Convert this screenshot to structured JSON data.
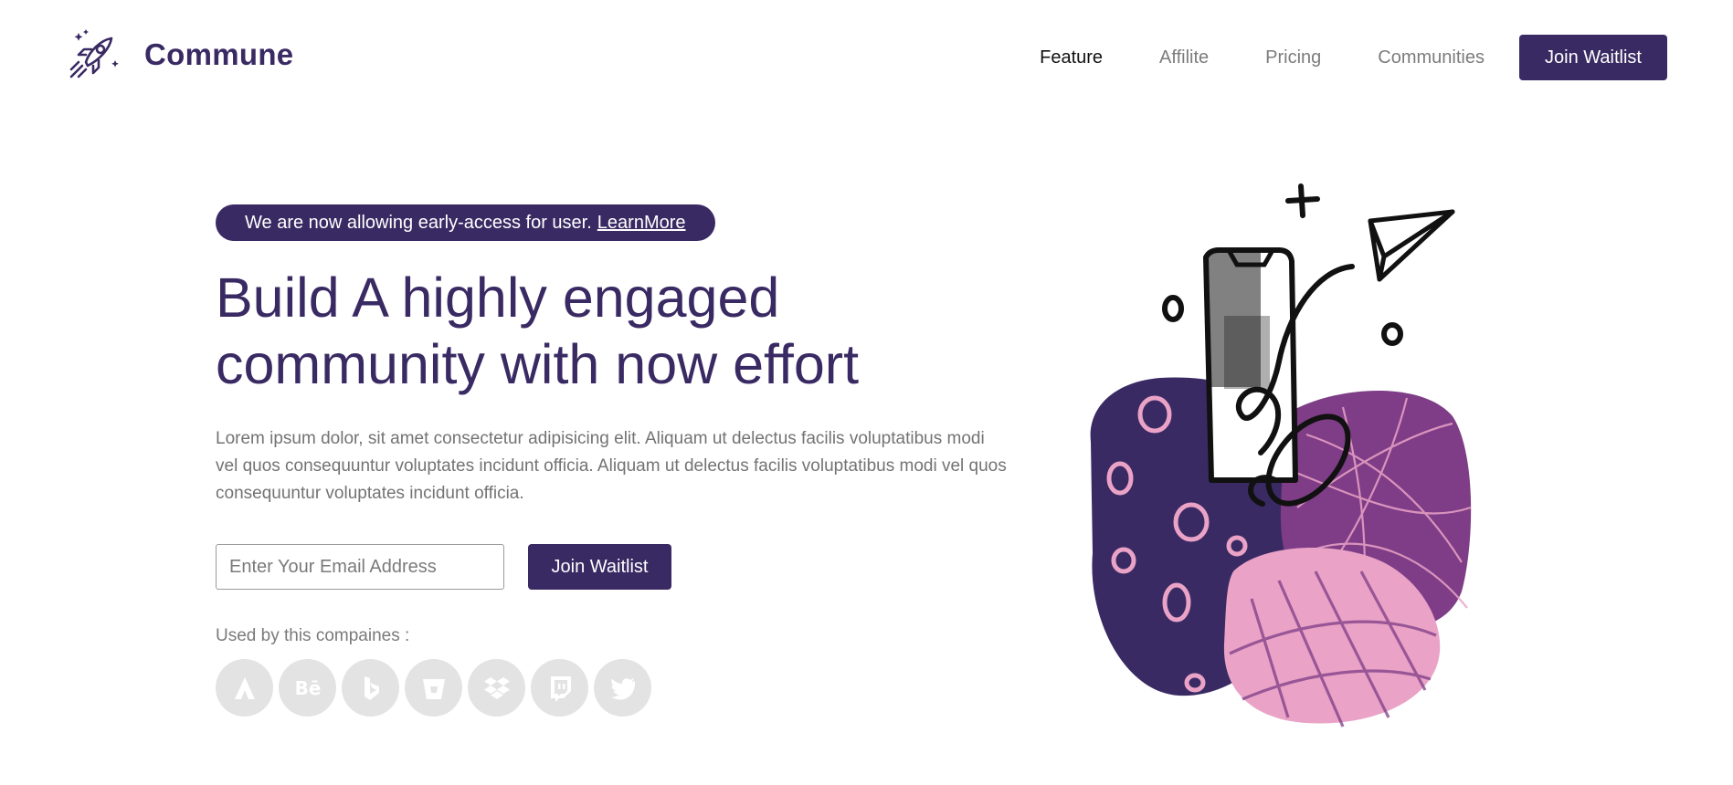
{
  "brand": {
    "name": "Commune",
    "logo_icon": "rocket-icon"
  },
  "nav": {
    "items": [
      {
        "label": "Feature",
        "active": true
      },
      {
        "label": "Affilite",
        "active": false
      },
      {
        "label": "Pricing",
        "active": false
      },
      {
        "label": "Communities",
        "active": false
      }
    ],
    "cta_label": "Join Waitlist"
  },
  "hero": {
    "announcement": "We are now allowing early-access for user.",
    "announcement_link": "LearnMore",
    "headline": "Build A highly engaged community with now effort",
    "description": "Lorem ipsum dolor, sit amet consectetur adipisicing elit. Aliquam ut delectus facilis voluptatibus modi vel quos consequuntur voluptates incidunt officia. Aliquam ut delectus facilis voluptatibus modi vel quos consequuntur voluptates incidunt officia.",
    "email_placeholder": "Enter Your Email Address",
    "cta_label": "Join Waitlist",
    "companies_label": "Used by this compaines :",
    "companies": [
      "atlassian-icon",
      "behance-icon",
      "bing-icon",
      "bitbucket-icon",
      "dropbox-icon",
      "twitch-icon",
      "twitter-icon"
    ]
  },
  "colors": {
    "primary": "#3a2a63",
    "purple": "#7e3d86",
    "pink": "#eaa3c7",
    "muted_text": "#737373",
    "logo_bg": "#e3e3e3"
  }
}
